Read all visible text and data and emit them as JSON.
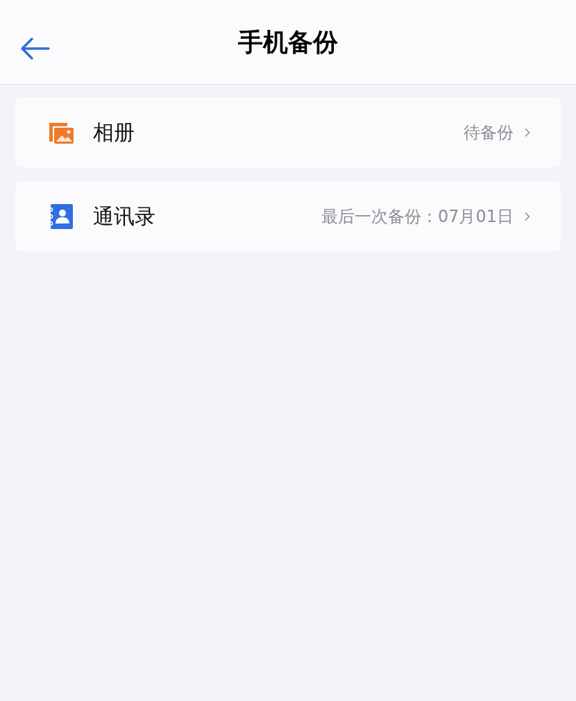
{
  "header": {
    "title": "手机备份"
  },
  "items": [
    {
      "kind": "photos",
      "label": "相册",
      "status": "待备份"
    },
    {
      "kind": "contacts",
      "label": "通讯录",
      "status": "最后一次备份：07月01日"
    }
  ]
}
